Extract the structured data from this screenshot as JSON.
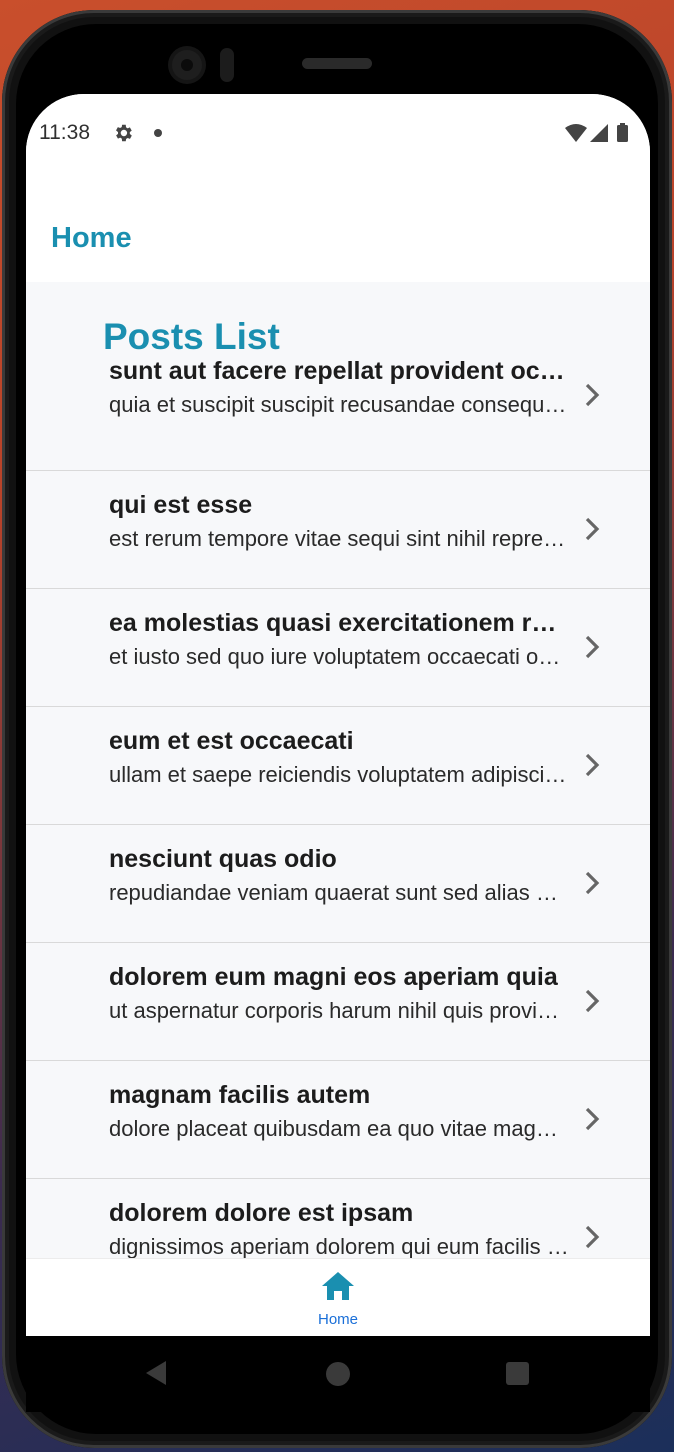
{
  "status_bar": {
    "time": "11:38",
    "icons": [
      "gear-icon",
      "notification-dot-icon",
      "wifi-icon",
      "signal-icon",
      "battery-icon"
    ]
  },
  "header": {
    "title": "Home"
  },
  "list": {
    "title": "Posts List",
    "posts": [
      {
        "title": "sunt aut facere repellat provident occaecati excepturi optio reprehenderit",
        "body": "quia et suscipit suscipit recusandae consequuntur expedita et cum"
      },
      {
        "title": "qui est esse",
        "body": "est rerum tempore vitae sequi sint nihil reprehenderit dolor beatae"
      },
      {
        "title": "ea molestias quasi exercitationem repellat qui ipsa sit aut",
        "body": "et iusto sed quo iure voluptatem occaecati omnis eligendi aut ad"
      },
      {
        "title": "eum et est occaecati",
        "body": "ullam et saepe reiciendis voluptatem adipisci sit amet autem assumenda"
      },
      {
        "title": "nesciunt quas odio",
        "body": "repudiandae veniam quaerat sunt sed alias aut fugiat sit autem sed est"
      },
      {
        "title": "dolorem eum magni eos aperiam quia",
        "body": "ut aspernatur corporis harum nihil quis provident sequi mollitia"
      },
      {
        "title": "magnam facilis autem",
        "body": "dolore placeat quibusdam ea quo vitae magni quis enim qui quis quo"
      },
      {
        "title": "dolorem dolore est ipsam",
        "body": "dignissimos aperiam dolorem qui eum facilis quibusdam animi sint"
      }
    ]
  },
  "bottom_nav": {
    "home_label": "Home",
    "home_icon": "home-icon"
  },
  "colors": {
    "accent": "#1a8fb0",
    "nav_active": "#1a6fd8"
  }
}
